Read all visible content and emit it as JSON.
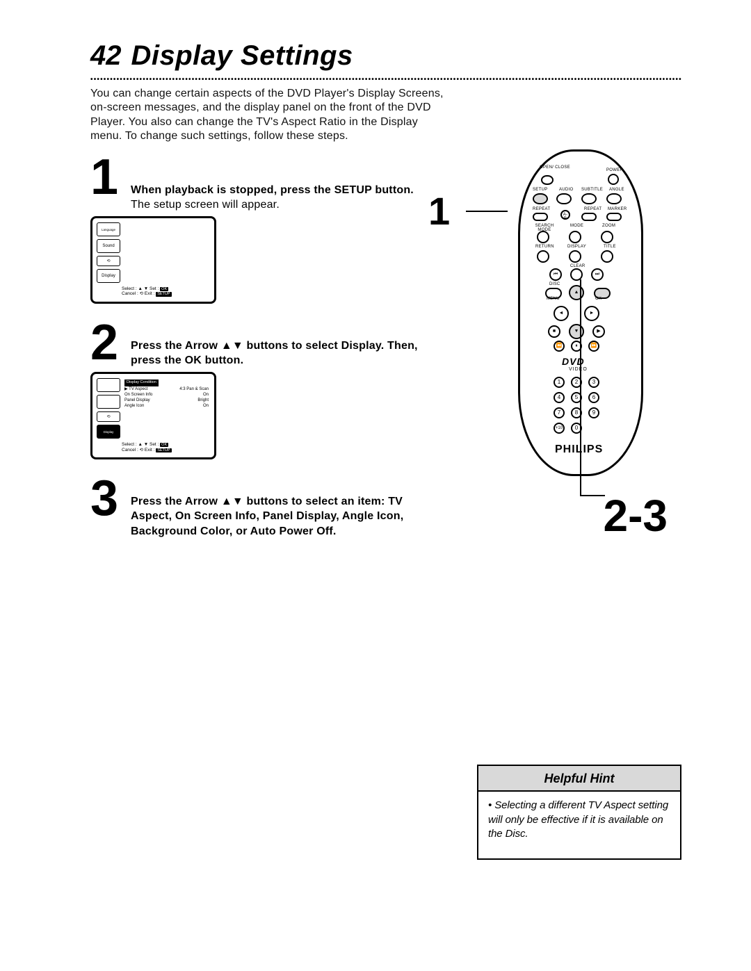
{
  "page": {
    "number": "42",
    "title": "Display Settings"
  },
  "intro": "You can change certain aspects of the DVD Player's Display Screens, on-screen messages, and the display panel on the front of the DVD Player. You also can change the TV's Aspect Ratio in the Display menu. To change such settings, follow these steps.",
  "steps": {
    "s1": {
      "num": "1",
      "bold": "When playback is stopped, press the SETUP button.",
      "rest": " The setup screen will appear."
    },
    "s2": {
      "num": "2",
      "bold_a": "Press the Arrow ",
      "bold_b": " buttons to select Display. Then, press the OK button."
    },
    "s3": {
      "num": "3",
      "bold_a": "Press the Arrow ",
      "bold_b": " buttons to select an item: TV Aspect, On Screen Info, Panel Display, Angle Icon, Background Color, or Auto Power Off."
    }
  },
  "osd": {
    "tabs": [
      "Language",
      "Sound",
      "Display"
    ],
    "helper_top": {
      "select": "Select :",
      "set": "Set :",
      "ok": "OK"
    },
    "helper_bottom": {
      "cancel": "Cancel :",
      "exit": "Exit :",
      "setup": "SETUP"
    },
    "detail": {
      "header": "Display Condition",
      "rows": [
        {
          "k": "▶ TV Aspect",
          "v": "4:3 Pan & Scan"
        },
        {
          "k": "On Screen Info",
          "v": "On"
        },
        {
          "k": "Panel Display",
          "v": "Bright"
        },
        {
          "k": "Angle Icon",
          "v": "On"
        }
      ]
    }
  },
  "callouts": {
    "top": "1",
    "bottom": "2-3"
  },
  "remote": {
    "labels": {
      "open_close": "OPEN/\nCLOSE",
      "power": "POWER",
      "setup": "SETUP",
      "audio": "AUDIO",
      "subtitle": "SUBTITLE",
      "angle": "ANGLE",
      "repeat": "REPEAT",
      "ab": "A-B",
      "repeat2": "REPEAT",
      "marker": "MARKER",
      "searchmode": "SEARCH MODE",
      "mode": "MODE",
      "zoom": "ZOOM",
      "return": "RETURN",
      "display": "DISPLAY",
      "title": "TITLE",
      "clear": "CLEAR",
      "disc": "DISC",
      "menu": "MENU",
      "ok": "OK"
    },
    "dvd": "DVD",
    "video": "VIDEO",
    "numbers": [
      "1",
      "2",
      "3",
      "4",
      "5",
      "6",
      "7",
      "8",
      "9",
      "+10",
      "0"
    ],
    "brand": "PHILIPS"
  },
  "hint": {
    "title": "Helpful Hint",
    "body": "Selecting a different TV Aspect setting will only be effective if it is available on the Disc."
  }
}
